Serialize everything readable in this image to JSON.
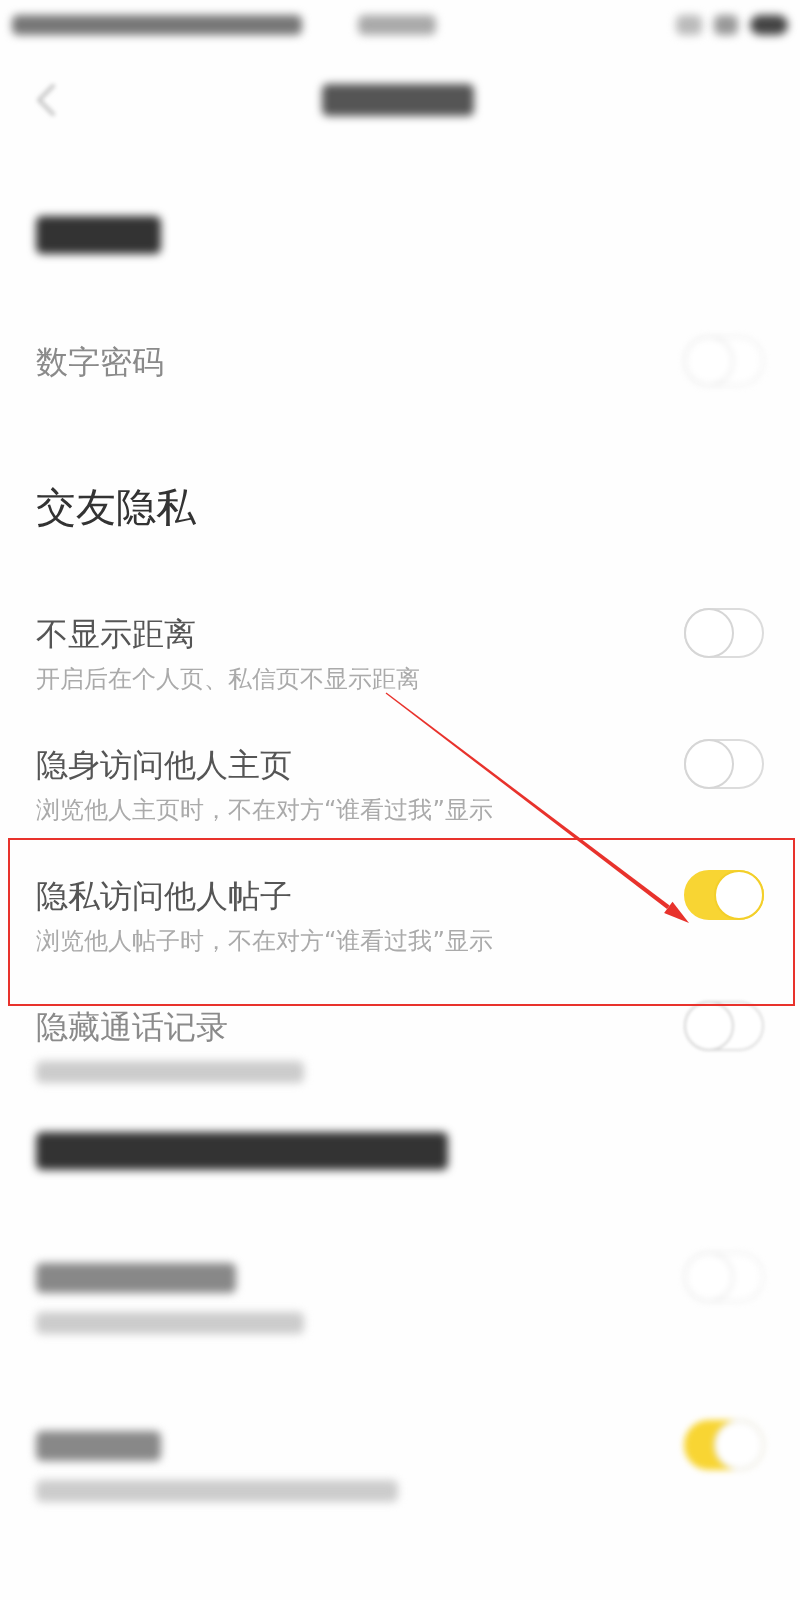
{
  "status_bar": {
    "illegible": true
  },
  "nav_bar": {
    "title_illegible": true
  },
  "sections": [
    {
      "title_illegible": true,
      "rows": [
        {
          "title": "数字密码",
          "on": false,
          "faded": true,
          "highlighted": false
        }
      ]
    },
    {
      "title": "交友隐私",
      "rows": [
        {
          "title": "不显示距离",
          "subtitle": "开启后在个人页、私信页不显示距离",
          "on": false,
          "faded": false,
          "highlighted": false
        },
        {
          "title": "隐身访问他人主页",
          "subtitle": "浏览他人主页时，不在对方“谁看过我”显示",
          "on": false,
          "faded": false,
          "highlighted": false
        },
        {
          "title": "隐私访问他人帖子",
          "subtitle": "浏览他人帖子时，不在对方“谁看过我”显示",
          "on": true,
          "faded": false,
          "highlighted": true
        },
        {
          "title": "隐藏通话记录",
          "subtitle_illegible": true,
          "on": false,
          "faded": true,
          "highlighted": false
        }
      ]
    },
    {
      "title_illegible": true,
      "rows": [
        {
          "title_illegible": true,
          "subtitle_illegible": true,
          "on": false,
          "faded": true,
          "highlighted": false
        },
        {
          "title_illegible": true,
          "subtitle_illegible": true,
          "on": true,
          "faded": true,
          "highlighted": false
        }
      ]
    }
  ]
}
